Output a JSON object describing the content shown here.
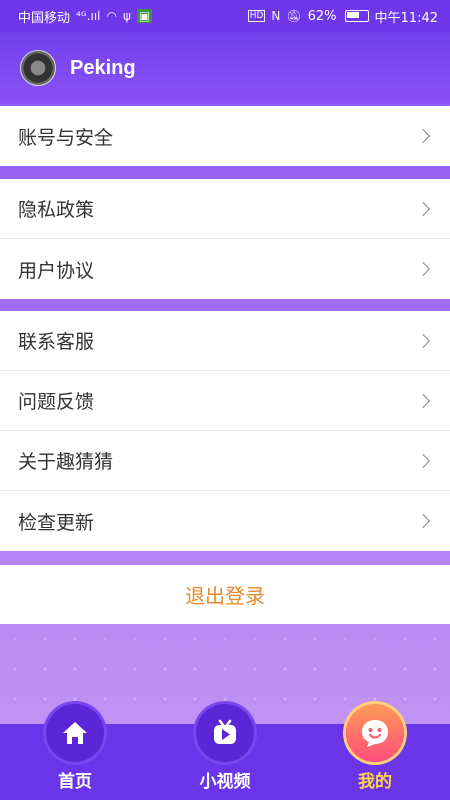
{
  "status_bar": {
    "carrier": "中国移动",
    "signal": "⁴ᴳ.ııl",
    "wifi": "wifi-icon",
    "usb": "usb-icon",
    "sim": "sim-icon",
    "hd": "HD",
    "nfc": "N",
    "battery_pct": "62%",
    "time": "中午11:42"
  },
  "header": {
    "username": "Peking"
  },
  "groups": [
    {
      "items": [
        {
          "label": "账号与安全"
        }
      ]
    },
    {
      "items": [
        {
          "label": "隐私政策"
        },
        {
          "label": "用户协议"
        }
      ]
    },
    {
      "items": [
        {
          "label": "联系客服"
        },
        {
          "label": "问题反馈"
        },
        {
          "label": "关于趣猜猜"
        },
        {
          "label": "检查更新"
        }
      ]
    }
  ],
  "logout": {
    "label": "退出登录"
  },
  "bottom_nav": {
    "items": [
      {
        "label": "首页",
        "icon": "home-icon",
        "active": false
      },
      {
        "label": "小视频",
        "icon": "video-icon",
        "active": false
      },
      {
        "label": "我的",
        "icon": "smile-icon",
        "active": true
      }
    ]
  },
  "colors": {
    "primary": "#6a35e8",
    "accent": "#e68a2e",
    "active_tab": "#ffd34a"
  }
}
